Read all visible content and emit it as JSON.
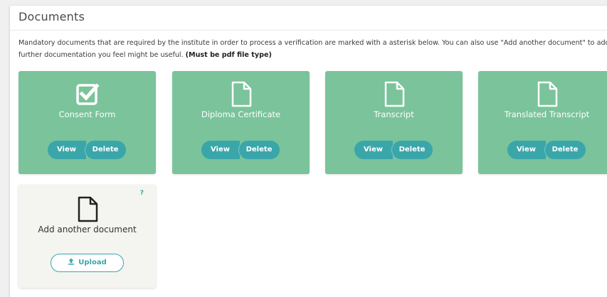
{
  "page": {
    "title": "Documents",
    "description_line1": "Mandatory documents that are required by the institute in order to process a verification are marked with a asterisk below. You can also use \"Add another document\" to add any",
    "description_line2": "further documentation you feel might be useful. ",
    "description_note": "(Must be pdf file type)"
  },
  "documents": [
    {
      "label": "Consent Form",
      "icon": "checkbox-checked-icon",
      "view_label": "View",
      "delete_label": "Delete"
    },
    {
      "label": "Diploma Certificate",
      "icon": "file-icon",
      "view_label": "View",
      "delete_label": "Delete"
    },
    {
      "label": "Transcript",
      "icon": "file-icon",
      "view_label": "View",
      "delete_label": "Delete"
    },
    {
      "label": "Translated Transcript",
      "icon": "file-icon",
      "view_label": "View",
      "delete_label": "Delete"
    }
  ],
  "add_document": {
    "label": "Add another document",
    "help": "?",
    "upload_label": "Upload",
    "icon": "file-icon",
    "upload_icon": "upload-icon"
  },
  "colors": {
    "card_green": "#7ac39b",
    "button_teal": "#3aa6aa",
    "add_card_bg": "#f4f4f0"
  }
}
